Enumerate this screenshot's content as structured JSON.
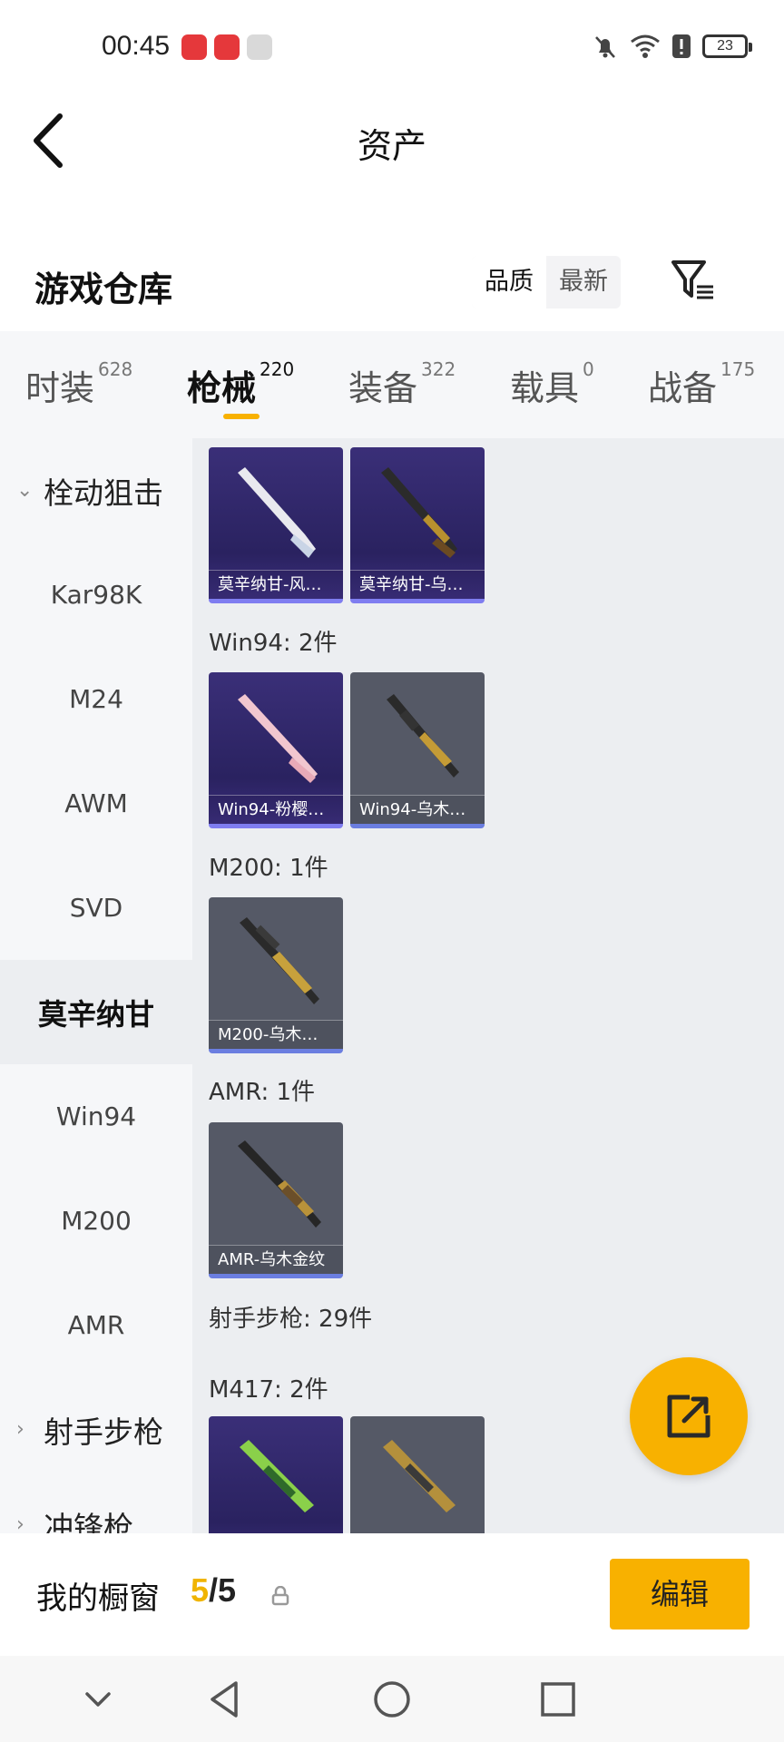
{
  "status_bar": {
    "time": "00:45",
    "battery": "23"
  },
  "header": {
    "title": "资产"
  },
  "warehouse": {
    "title": "游戏仓库",
    "sort_options": [
      "品质",
      "最新"
    ]
  },
  "tabs": [
    {
      "label": "时装",
      "count": "628"
    },
    {
      "label": "枪械",
      "count": "220"
    },
    {
      "label": "装备",
      "count": "322"
    },
    {
      "label": "载具",
      "count": "0"
    },
    {
      "label": "战备",
      "count": "175"
    }
  ],
  "sidebar": {
    "groups": {
      "bolt": "栓动狙击",
      "marksman": "射手步枪",
      "smg": "冲锋枪"
    },
    "items": [
      "Kar98K",
      "M24",
      "AWM",
      "SVD",
      "莫辛纳甘",
      "Win94",
      "M200",
      "AMR"
    ]
  },
  "content": {
    "sections": [
      {
        "label": "",
        "items": [
          "莫辛纳甘-风…",
          "莫辛纳甘-乌…"
        ]
      },
      {
        "label": "Win94: 2件",
        "items": [
          "Win94-粉樱…",
          "Win94-乌木…"
        ]
      },
      {
        "label": "M200: 1件",
        "items": [
          "M200-乌木…"
        ]
      },
      {
        "label": "AMR: 1件",
        "items": [
          "AMR-乌木金纹"
        ]
      },
      {
        "label": "射手步枪: 29件",
        "items": []
      },
      {
        "label": "M417: 2件",
        "items": [
          "",
          ""
        ]
      }
    ]
  },
  "showcase": {
    "label": "我的橱窗",
    "current": "5",
    "separator": "/",
    "total": "5",
    "edit_label": "编辑"
  },
  "colors": {
    "accent": "#f8b100",
    "count_highlight": "#f0b400",
    "card_purple": "#2a2260",
    "card_gray": "#555966"
  }
}
